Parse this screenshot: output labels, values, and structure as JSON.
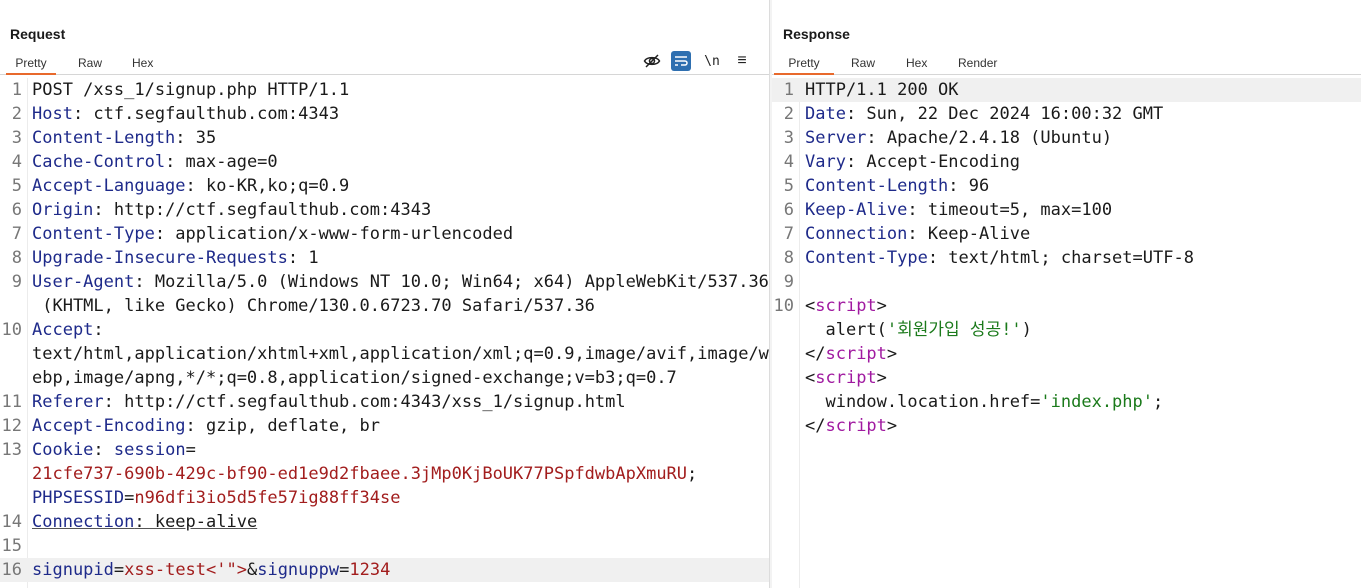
{
  "request": {
    "title": "Request",
    "tabs": [
      "Pretty",
      "Raw",
      "Hex"
    ],
    "active_tab": "Pretty",
    "toolbar_icons": [
      "eye-slash-icon",
      "wrap-icon",
      "newline-icon",
      "menu-icon"
    ],
    "toolbar_text": {
      "newline": "\\n",
      "menu": "≡"
    },
    "lines": [
      {
        "n": "1",
        "segs": [
          [
            "v",
            "POST /xss_1/signup.php HTTP/1.1"
          ]
        ]
      },
      {
        "n": "2",
        "segs": [
          [
            "k",
            "Host"
          ],
          [
            "v",
            ": ctf.segfaulthub.com:4343"
          ]
        ]
      },
      {
        "n": "3",
        "segs": [
          [
            "k",
            "Content-Length"
          ],
          [
            "v",
            ": 35"
          ]
        ]
      },
      {
        "n": "4",
        "segs": [
          [
            "k",
            "Cache-Control"
          ],
          [
            "v",
            ": max-age=0"
          ]
        ]
      },
      {
        "n": "5",
        "segs": [
          [
            "k",
            "Accept-Language"
          ],
          [
            "v",
            ": ko-KR,ko;q=0.9"
          ]
        ]
      },
      {
        "n": "6",
        "segs": [
          [
            "k",
            "Origin"
          ],
          [
            "v",
            ": http://ctf.segfaulthub.com:4343"
          ]
        ]
      },
      {
        "n": "7",
        "segs": [
          [
            "k",
            "Content-Type"
          ],
          [
            "v",
            ": application/x-www-form-urlencoded"
          ]
        ]
      },
      {
        "n": "8",
        "segs": [
          [
            "k",
            "Upgrade-Insecure-Requests"
          ],
          [
            "v",
            ": 1"
          ]
        ]
      },
      {
        "n": "9",
        "segs": [
          [
            "k",
            "User-Agent"
          ],
          [
            "v",
            ": Mozilla/5.0 (Windows NT 10.0; Win64; x64) AppleWebKit/537.36"
          ]
        ]
      },
      {
        "n": "",
        "segs": [
          [
            "v",
            " (KHTML, like Gecko) Chrome/130.0.6723.70 Safari/537.36"
          ]
        ]
      },
      {
        "n": "10",
        "segs": [
          [
            "k",
            "Accept"
          ],
          [
            "v",
            ":"
          ]
        ]
      },
      {
        "n": "",
        "segs": [
          [
            "v",
            "text/html,application/xhtml+xml,application/xml;q=0.9,image/avif,image/w"
          ]
        ]
      },
      {
        "n": "",
        "segs": [
          [
            "v",
            "ebp,image/apng,*/*;q=0.8,application/signed-exchange;v=b3;q=0.7"
          ]
        ]
      },
      {
        "n": "11",
        "segs": [
          [
            "k",
            "Referer"
          ],
          [
            "v",
            ": http://ctf.segfaulthub.com:4343/xss_1/signup.html"
          ]
        ]
      },
      {
        "n": "12",
        "segs": [
          [
            "k",
            "Accept-Encoding"
          ],
          [
            "v",
            ": gzip, deflate, br"
          ]
        ]
      },
      {
        "n": "13",
        "segs": [
          [
            "k",
            "Cookie"
          ],
          [
            "v",
            ": "
          ],
          [
            "k",
            "session"
          ],
          [
            "v",
            "="
          ]
        ]
      },
      {
        "n": "",
        "segs": [
          [
            "cv",
            "21cfe737-690b-429c-bf90-ed1e9d2fbaee.3jMp0KjBoUK77PSpfdwbApXmuRU"
          ],
          [
            "v",
            ";"
          ]
        ]
      },
      {
        "n": "",
        "segs": [
          [
            "k",
            "PHPSESSID"
          ],
          [
            "v",
            "="
          ],
          [
            "cv",
            "n96dfi3io5d5fe57ig88ff34se"
          ]
        ]
      },
      {
        "n": "14",
        "segs": [
          [
            "k",
            "Connection"
          ],
          [
            "v",
            ": keep-alive"
          ]
        ],
        "underline": true
      },
      {
        "n": "15",
        "segs": []
      },
      {
        "n": "16",
        "segs": [
          [
            "k",
            "signupid"
          ],
          [
            "v",
            "="
          ],
          [
            "cv",
            "xss-test<'\">"
          ],
          [
            "v",
            "&"
          ],
          [
            "k",
            "signuppw"
          ],
          [
            "v",
            "="
          ],
          [
            "cv",
            "1234"
          ]
        ],
        "highlight": true
      }
    ]
  },
  "response": {
    "title": "Response",
    "tabs": [
      "Pretty",
      "Raw",
      "Hex",
      "Render"
    ],
    "active_tab": "Pretty",
    "lines": [
      {
        "n": "1",
        "segs": [
          [
            "v",
            "HTTP/1.1 200 OK"
          ]
        ],
        "highlight": true
      },
      {
        "n": "2",
        "segs": [
          [
            "k",
            "Date"
          ],
          [
            "v",
            ": Sun, 22 Dec 2024 16:00:32 GMT"
          ]
        ]
      },
      {
        "n": "3",
        "segs": [
          [
            "k",
            "Server"
          ],
          [
            "v",
            ": Apache/2.4.18 (Ubuntu)"
          ]
        ]
      },
      {
        "n": "4",
        "segs": [
          [
            "k",
            "Vary"
          ],
          [
            "v",
            ": Accept-Encoding"
          ]
        ]
      },
      {
        "n": "5",
        "segs": [
          [
            "k",
            "Content-Length"
          ],
          [
            "v",
            ": 96"
          ]
        ]
      },
      {
        "n": "6",
        "segs": [
          [
            "k",
            "Keep-Alive"
          ],
          [
            "v",
            ": timeout=5, max=100"
          ]
        ]
      },
      {
        "n": "7",
        "segs": [
          [
            "k",
            "Connection"
          ],
          [
            "v",
            ": Keep-Alive"
          ]
        ]
      },
      {
        "n": "8",
        "segs": [
          [
            "k",
            "Content-Type"
          ],
          [
            "v",
            ": text/html; charset=UTF-8"
          ]
        ]
      },
      {
        "n": "9",
        "segs": []
      },
      {
        "n": "10",
        "segs": [
          [
            "v",
            "<"
          ],
          [
            "tag",
            "script"
          ],
          [
            "v",
            ">"
          ]
        ]
      },
      {
        "n": "",
        "segs": [
          [
            "v",
            "  alert("
          ],
          [
            "str",
            "'회원가입 성공!'"
          ],
          [
            "v",
            ")"
          ]
        ]
      },
      {
        "n": "",
        "segs": [
          [
            "v",
            "</"
          ],
          [
            "tag",
            "script"
          ],
          [
            "v",
            ">"
          ]
        ]
      },
      {
        "n": "",
        "segs": [
          [
            "v",
            "<"
          ],
          [
            "tag",
            "script"
          ],
          [
            "v",
            ">"
          ]
        ]
      },
      {
        "n": "",
        "segs": [
          [
            "v",
            "  window.location.href="
          ],
          [
            "str",
            "'index.php'"
          ],
          [
            "v",
            ";"
          ]
        ]
      },
      {
        "n": "",
        "segs": [
          [
            "v",
            "</"
          ],
          [
            "tag",
            "script"
          ],
          [
            "v",
            ">"
          ]
        ]
      }
    ]
  },
  "colors": {
    "accent": "#e8692c",
    "header_key": "#1e2a8a",
    "cookie_value": "#a21d1d",
    "html_tag": "#a01aa0",
    "string": "#1b7a1b",
    "toggle_selected": "#2e6fb0"
  }
}
